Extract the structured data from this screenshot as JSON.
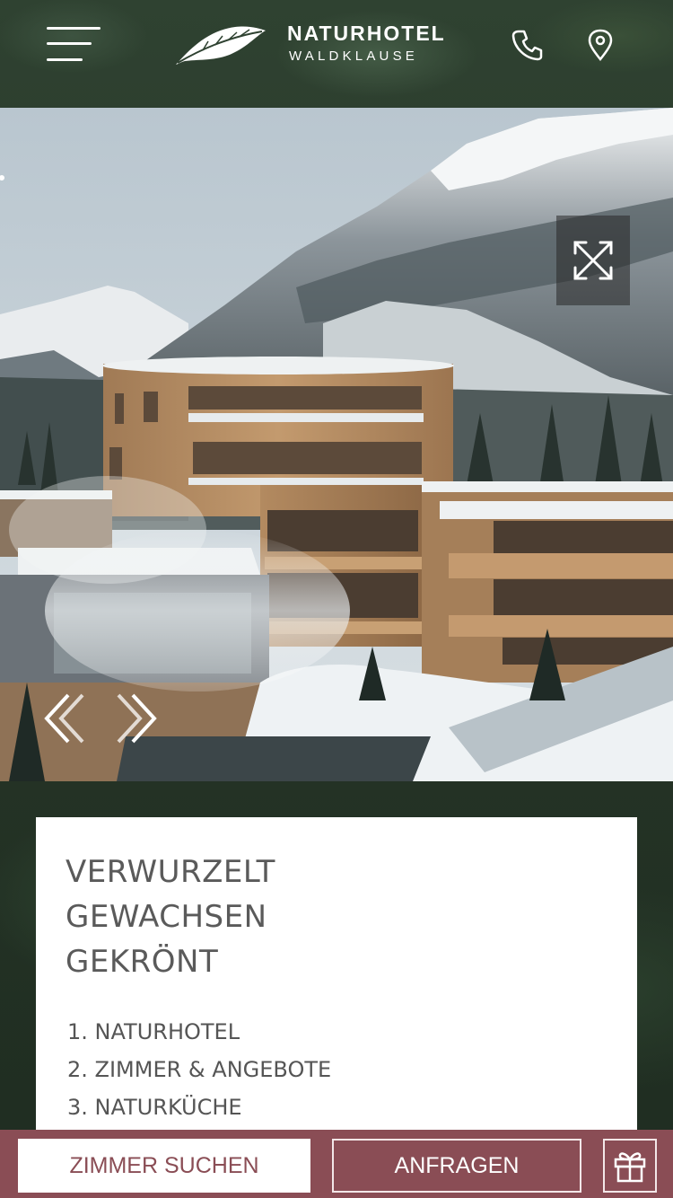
{
  "header": {
    "logo_name": "NATURHOTEL",
    "logo_sub": "WALDKLAUSE",
    "menu_icon": "hamburger-menu-icon",
    "phone_icon": "phone-icon",
    "location_icon": "map-pin-icon"
  },
  "hero": {
    "expand_icon": "expand-icon",
    "prev_icon": "chevron-left-icon",
    "next_icon": "chevron-right-icon"
  },
  "card": {
    "title_lines": [
      "VERWURZELT",
      "GEWACHSEN",
      "GEKRÖNT"
    ],
    "items": [
      "1. NATURHOTEL",
      "2. ZIMMER & ANGEBOTE",
      "3. NATURKÜCHE"
    ]
  },
  "bottom_bar": {
    "search_label": "ZIMMER SUCHEN",
    "inquire_label": "ANFRAGEN",
    "gift_icon": "gift-icon"
  },
  "colors": {
    "brand": "#8a4d55",
    "card_text": "#5a5a5a"
  }
}
